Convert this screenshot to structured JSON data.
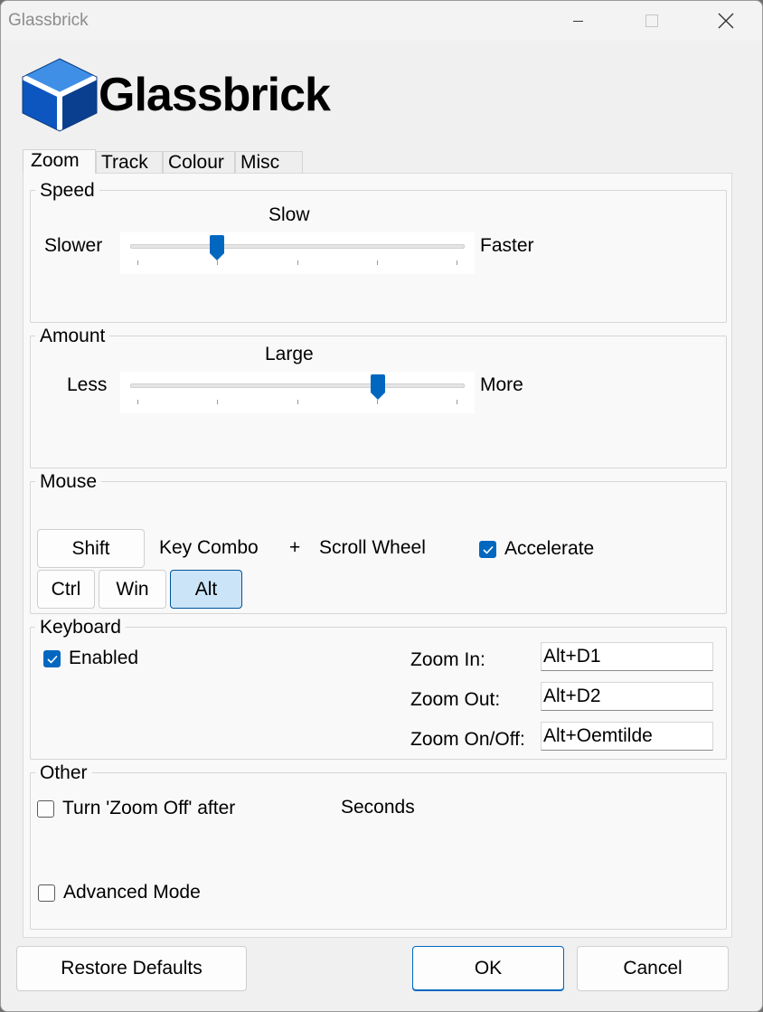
{
  "window": {
    "title": "Glassbrick"
  },
  "brand": {
    "name": "Glassbrick"
  },
  "tabs": [
    "Zoom",
    "Track",
    "Colour",
    "Misc"
  ],
  "speed": {
    "title": "Speed",
    "value_label": "Slow",
    "min_label": "Slower",
    "max_label": "Faster",
    "position": 0.26
  },
  "amount": {
    "title": "Amount",
    "value_label": "Large",
    "min_label": "Less",
    "max_label": "More",
    "position": 0.74
  },
  "mouse": {
    "title": "Mouse",
    "shift": "Shift",
    "key_combo": "Key Combo",
    "plus": "+",
    "scroll_wheel": "Scroll Wheel",
    "accelerate": "Accelerate",
    "ctrl": "Ctrl",
    "win": "Win",
    "alt": "Alt"
  },
  "keyboard": {
    "title": "Keyboard",
    "enabled": "Enabled",
    "zoom_in_label": "Zoom In:",
    "zoom_in_value": "Alt+D1",
    "zoom_out_label": "Zoom Out:",
    "zoom_out_value": "Alt+D2",
    "zoom_toggle_label": "Zoom On/Off:",
    "zoom_toggle_value": "Alt+Oemtilde"
  },
  "other": {
    "title": "Other",
    "turn_off": "Turn 'Zoom Off' after",
    "seconds": "Seconds",
    "advanced": "Advanced Mode"
  },
  "footer": {
    "restore": "Restore Defaults",
    "ok": "OK",
    "cancel": "Cancel"
  },
  "colors": {
    "accent": "#0067c0",
    "logo_dark": "#0a3f8f",
    "logo_light": "#3f8fe6"
  }
}
